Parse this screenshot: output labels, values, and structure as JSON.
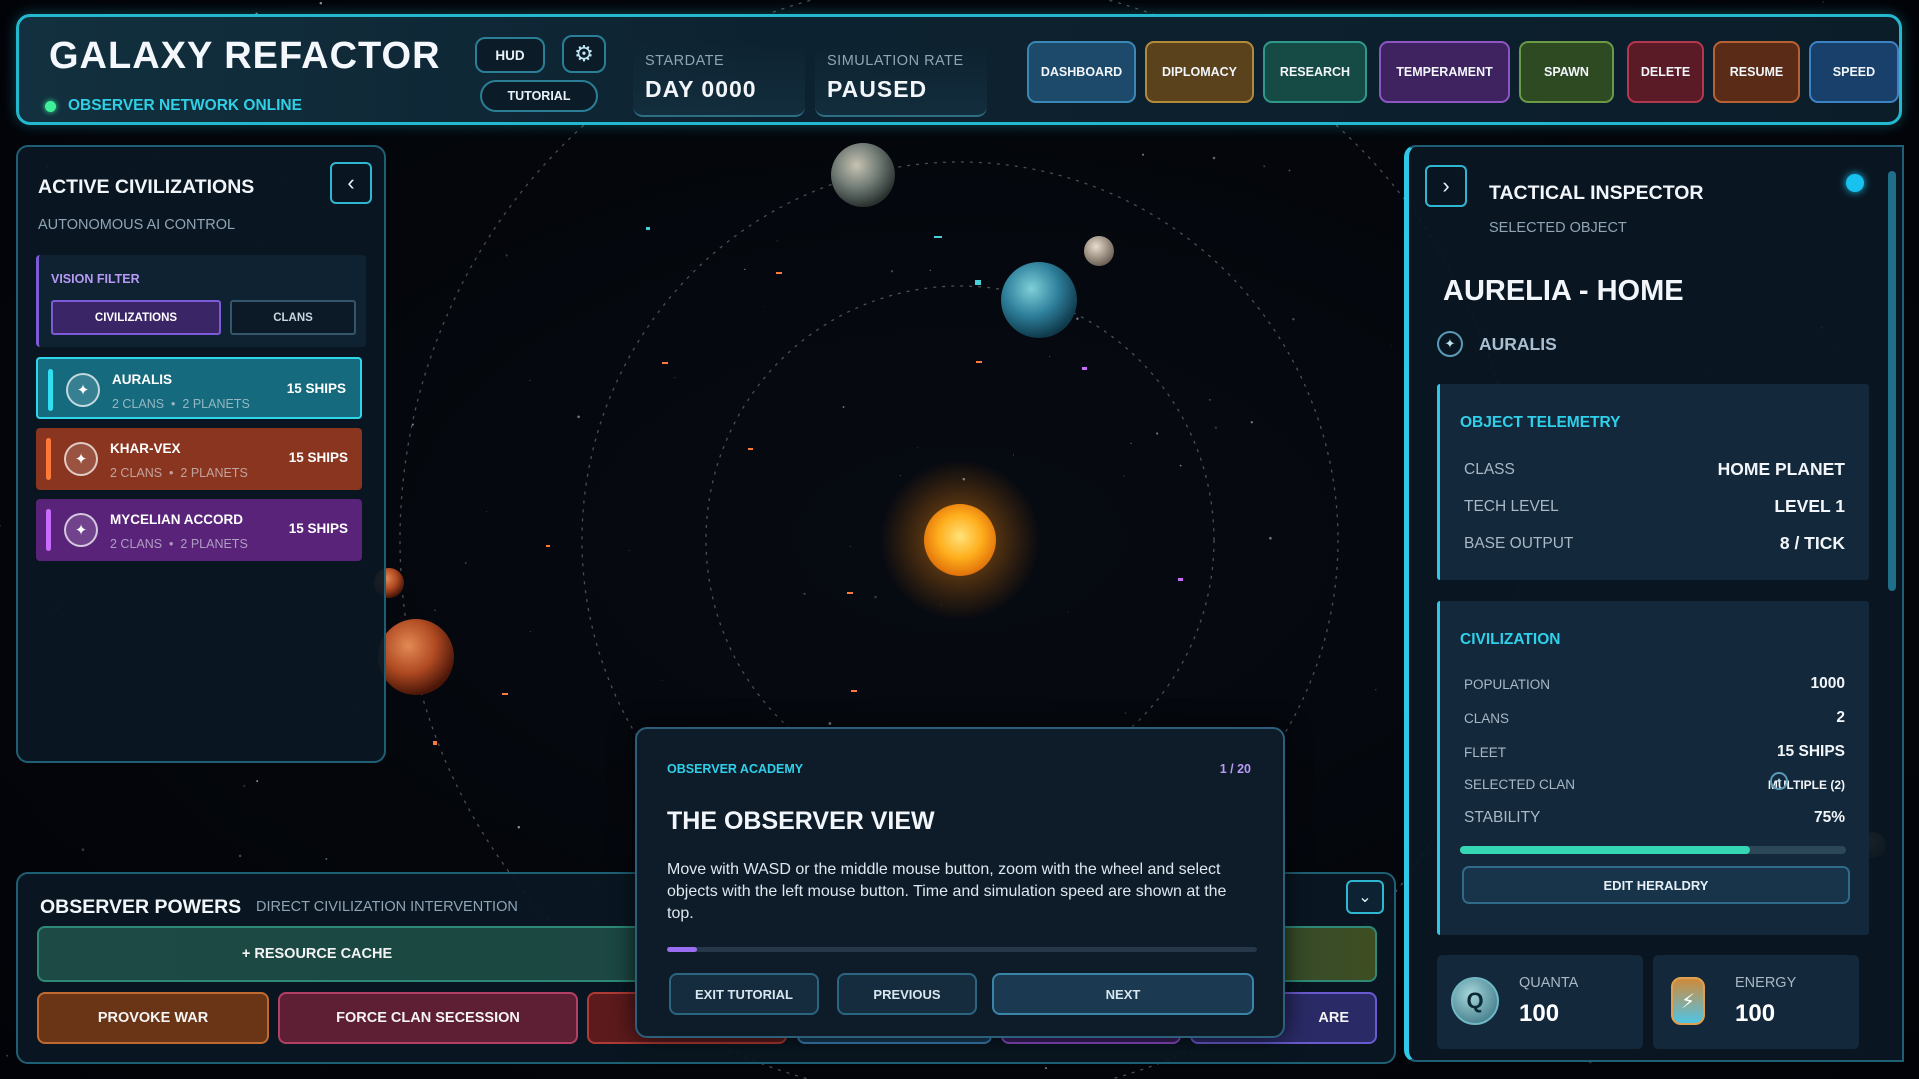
{
  "header": {
    "title": "GALAXY REFACTOR",
    "network_status": "OBSERVER NETWORK ONLINE",
    "hud_label": "HUD",
    "tutorial_label": "TUTORIAL",
    "stardate_label": "STARDATE",
    "stardate_value": "DAY 0000",
    "sim_rate_label": "SIMULATION RATE",
    "sim_rate_value": "PAUSED",
    "nav": [
      {
        "label": "DASHBOARD",
        "color": "#1d4a6b",
        "border": "#3a86b4"
      },
      {
        "label": "DIPLOMACY",
        "color": "#5a431c",
        "border": "#b38a3c"
      },
      {
        "label": "RESEARCH",
        "color": "#154a45",
        "border": "#2f9a8b"
      },
      {
        "label": "TEMPERAMENT",
        "color": "#3f2260",
        "border": "#8b55c2"
      },
      {
        "label": "SPAWN",
        "color": "#2d4a22",
        "border": "#6a9a45"
      },
      {
        "label": "DELETE",
        "color": "#5a1a26",
        "border": "#b3384e"
      },
      {
        "label": "RESUME",
        "color": "#5a2c18",
        "border": "#b86133"
      },
      {
        "label": "SPEED",
        "color": "#19406a",
        "border": "#3d82c2"
      }
    ]
  },
  "civ_panel": {
    "title": "ACTIVE CIVILIZATIONS",
    "subtitle": "AUTONOMOUS AI CONTROL",
    "filter_label": "VISION FILTER",
    "filter_options": [
      "CIVILIZATIONS",
      "CLANS"
    ],
    "civs": [
      {
        "name": "AURALIS",
        "clans": "2 CLANS",
        "planets": "2 PLANETS",
        "ships": "15 SHIPS",
        "bg": "#156a7e",
        "accent": "#2fe0f0"
      },
      {
        "name": "KHAR-VEX",
        "clans": "2 CLANS",
        "planets": "2 PLANETS",
        "ships": "15 SHIPS",
        "bg": "#8a3520",
        "accent": "#ff7a3a"
      },
      {
        "name": "MYCELIAN ACCORD",
        "clans": "2 CLANS",
        "planets": "2 PLANETS",
        "ships": "15 SHIPS",
        "bg": "#5a237a",
        "accent": "#c86cff"
      }
    ]
  },
  "inspector": {
    "title": "TACTICAL INSPECTOR",
    "subtitle": "SELECTED OBJECT",
    "object_name": "AURELIA - HOME",
    "owner": "AURALIS",
    "telemetry_title": "OBJECT TELEMETRY",
    "telemetry": [
      {
        "k": "CLASS",
        "v": "HOME PLANET"
      },
      {
        "k": "TECH LEVEL",
        "v": "LEVEL 1"
      },
      {
        "k": "BASE OUTPUT",
        "v": "8 / TICK"
      }
    ],
    "civ_title": "CIVILIZATION",
    "civ_rows": [
      {
        "k": "POPULATION",
        "v": "1000"
      },
      {
        "k": "CLANS",
        "v": "2"
      },
      {
        "k": "FLEET",
        "v": "15 SHIPS"
      },
      {
        "k": "SELECTED CLAN",
        "v": "MULTIPLE (2)"
      }
    ],
    "stability_label": "STABILITY",
    "stability_value": "75%",
    "stability_fraction": 0.75,
    "edit_label": "EDIT HERALDRY",
    "quanta_label": "QUANTA",
    "quanta_value": "100",
    "energy_label": "ENERGY",
    "energy_value": "100"
  },
  "powers": {
    "title": "OBSERVER POWERS",
    "subtitle": "DIRECT CIVILIZATION INTERVENTION",
    "resource_cache": "+ RESOURCE CACHE",
    "provoke_war": "PROVOKE WAR",
    "force_secession": "FORCE CLAN SECESSION",
    "partial_label": "ARE"
  },
  "tutorial": {
    "kicker": "OBSERVER ACADEMY",
    "step": "1 / 20",
    "step_fraction": 0.05,
    "heading": "THE OBSERVER VIEW",
    "body": "Move with WASD or the middle mouse button, zoom with the wheel and select objects with the left mouse button. Time and simulation speed are shown at the top.",
    "exit": "EXIT TUTORIAL",
    "previous": "PREVIOUS",
    "next": "NEXT"
  }
}
